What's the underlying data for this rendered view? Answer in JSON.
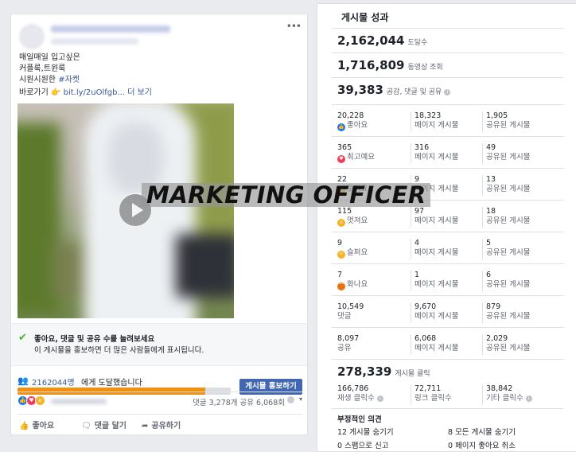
{
  "post": {
    "caption_lines": [
      "매일매일 입고싶은",
      "커플룩,트윈룩",
      "시원시원한 "
    ],
    "hashtag": "#자켓",
    "link_prefix": "바로가기 ",
    "link_emoji": "👉",
    "link_url": "bit.ly/2uOlfgb...",
    "see_more": "더 보기",
    "boost_tip_title": "좋아요, 댓글 및 공유 수를 늘려보세요",
    "boost_tip_sub": "이 게시물을 홍보하면 더 많은 사람들에게 표시됩니다.",
    "reach_count": "2162044명",
    "reach_text": "에게 도달했습니다",
    "reach_progress_percent": 88,
    "boost_button": "게시물 홍보하기",
    "reaction_counts": "댓글 3,278개  공유 6,068회",
    "actions": {
      "like": "좋아요",
      "comment": "댓글 달기",
      "share": "공유하기"
    },
    "more_icon": "more-dots-icon"
  },
  "insights": {
    "title": "게시물 성과",
    "reach": {
      "value": "2,162,044",
      "label": "도달수"
    },
    "views": {
      "value": "1,716,809",
      "label": "동영상 조회"
    },
    "engagement": {
      "value": "39,383",
      "label": "공감, 댓글 및 공유"
    },
    "grid": [
      {
        "a": "20,228",
        "a_label": "좋아요",
        "a_icon": "like-icon",
        "b": "18,323",
        "b_label": "페이지 게시물",
        "c": "1,905",
        "c_label": "공유된 게시물"
      },
      {
        "a": "365",
        "a_label": "최고예요",
        "a_icon": "love-icon",
        "b": "316",
        "b_label": "페이지 게시물",
        "c": "49",
        "c_label": "공유된 게시물"
      },
      {
        "a": "22",
        "a_label": "웃겨요",
        "a_icon": "haha-icon",
        "b": "9",
        "b_label": "페이지 게시물",
        "c": "13",
        "c_label": "공유된 게시물"
      },
      {
        "a": "115",
        "a_label": "멋져요",
        "a_icon": "wow-icon",
        "b": "97",
        "b_label": "페이지 게시물",
        "c": "18",
        "c_label": "공유된 게시물"
      },
      {
        "a": "9",
        "a_label": "슬퍼요",
        "a_icon": "sad-icon",
        "b": "4",
        "b_label": "페이지 게시물",
        "c": "5",
        "c_label": "공유된 게시물"
      },
      {
        "a": "7",
        "a_label": "화나요",
        "a_icon": "angry-icon",
        "b": "1",
        "b_label": "페이지 게시물",
        "c": "6",
        "c_label": "공유된 게시물"
      },
      {
        "a": "10,549",
        "a_label": "댓글",
        "a_icon": "",
        "b": "9,670",
        "b_label": "페이지 게시물",
        "c": "879",
        "c_label": "공유된 게시물"
      },
      {
        "a": "8,097",
        "a_label": "공유",
        "a_icon": "",
        "b": "6,068",
        "b_label": "페이지 게시물",
        "c": "2,029",
        "c_label": "공유된 게시물"
      }
    ],
    "clicks": {
      "value": "278,339",
      "label": "게시물 클릭"
    },
    "click_breakdown": [
      {
        "value": "166,786",
        "label": "재생 클릭수"
      },
      {
        "value": "72,711",
        "label": "링크 클릭수"
      },
      {
        "value": "38,842",
        "label": "기타 클릭수"
      }
    ],
    "negative": {
      "title": "부정적인 의견",
      "items": [
        "12 게시물 숨기기",
        "8 모든 게시물 숨기기",
        "0 스팸으로 신고",
        "0 페이지 좋아요 취소"
      ]
    }
  },
  "overlay": {
    "banner_text": "MARKETING OFFICER"
  },
  "colors": {
    "accent": "#4267b2",
    "link": "#385898",
    "progress": "#f28f0f",
    "check": "#42b72a"
  }
}
